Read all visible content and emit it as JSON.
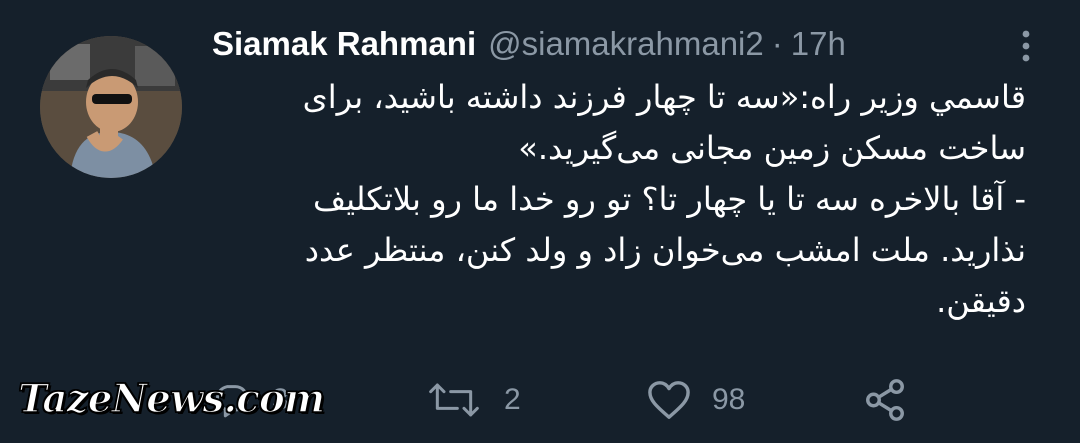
{
  "tweet": {
    "author": {
      "display_name": "Siamak Rahmani",
      "handle": "@siamakrahmani2",
      "separator": "·",
      "time": "17h"
    },
    "body_lines": [
      "قاسمي وزير راه:«سه تا چهار فرزند داشته باشید، برای",
      "ساخت مسکن زمین مجانی می‌گیرید.»",
      "- آقا بالاخره سه تا یا چهار تا؟ تو رو خدا ما رو بلاتکلیف",
      "نذارید. ملت امشب می‌خوان زاد و ولد کنن، منتظر عدد",
      "دقیقن."
    ],
    "actions": {
      "reply_count": "3",
      "retweet_count": "2",
      "like_count": "98"
    }
  },
  "watermark": "TazeNews.com",
  "icons": {
    "more": "more-vertical-icon",
    "reply": "reply-icon",
    "retweet": "retweet-icon",
    "like": "heart-icon",
    "share": "share-icon"
  },
  "colors": {
    "background": "#15202b",
    "primary_text": "#ffffff",
    "secondary_text": "#8b98a5"
  }
}
